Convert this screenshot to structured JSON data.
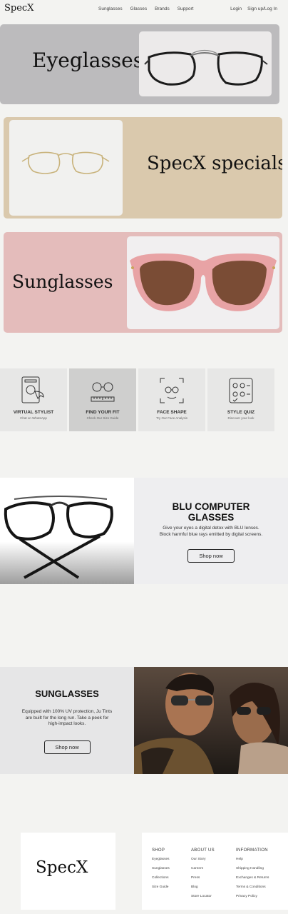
{
  "nav": {
    "logo": "SpecX",
    "links": [
      "Sunglasses",
      "Glasses",
      "Brands",
      "Support"
    ],
    "login": "Login",
    "signup": "Sign up/Log In"
  },
  "hero": [
    {
      "title": "Eyeglasses"
    },
    {
      "title": "SpecX specials"
    },
    {
      "title": "Sunglasses"
    }
  ],
  "services": [
    {
      "name": "VIRTUAL STYLIST",
      "sub": "Chat on WhatsApp",
      "icon": "phone-chat-icon"
    },
    {
      "name": "FIND YOUR FIT",
      "sub": "Check Our Size Guide",
      "icon": "glasses-ruler-icon"
    },
    {
      "name": "FACE SHAPE",
      "sub": "Try Our Face Analysis",
      "icon": "face-scan-icon"
    },
    {
      "name": "STYLE QUIZ",
      "sub": "Discover your look",
      "icon": "quiz-checklist-icon"
    }
  ],
  "blu": {
    "title_line1": "BLU COMPUTER",
    "title_line2": "GLASSES",
    "desc_line1": "Give your eyes a digital detox with BLU lenses.",
    "desc_line2": "Block harmful blue rays emitted by digital screens.",
    "button": "Shop now"
  },
  "sun": {
    "title": "SUNGLASSES",
    "desc_line1": "Equipped with 100% UV protection, Ju Tints",
    "desc_line2": "are built for the long run. Take a peek for",
    "desc_line3": "high-impact looks.",
    "button": "Shop now"
  },
  "footer": {
    "logo": "SpecX",
    "columns": [
      {
        "heading": "SHOP",
        "links": [
          "Eyeglasses",
          "Sunglasses",
          "Collections",
          "Size Guide"
        ]
      },
      {
        "heading": "ABOUT US",
        "links": [
          "Our Story",
          "Careers",
          "Press",
          "Blog",
          "Store Locator"
        ]
      },
      {
        "heading": "INFORMATION",
        "links": [
          "Help",
          "Shipping Handling",
          "Exchanges & Returns",
          "Terms & Conditions",
          "Privacy Policy"
        ]
      }
    ]
  },
  "colors": {
    "eyeglasses_card": "#bcbbbd",
    "specials_card": "#dac9ad",
    "sunglasses_card": "#e4bcbb"
  }
}
